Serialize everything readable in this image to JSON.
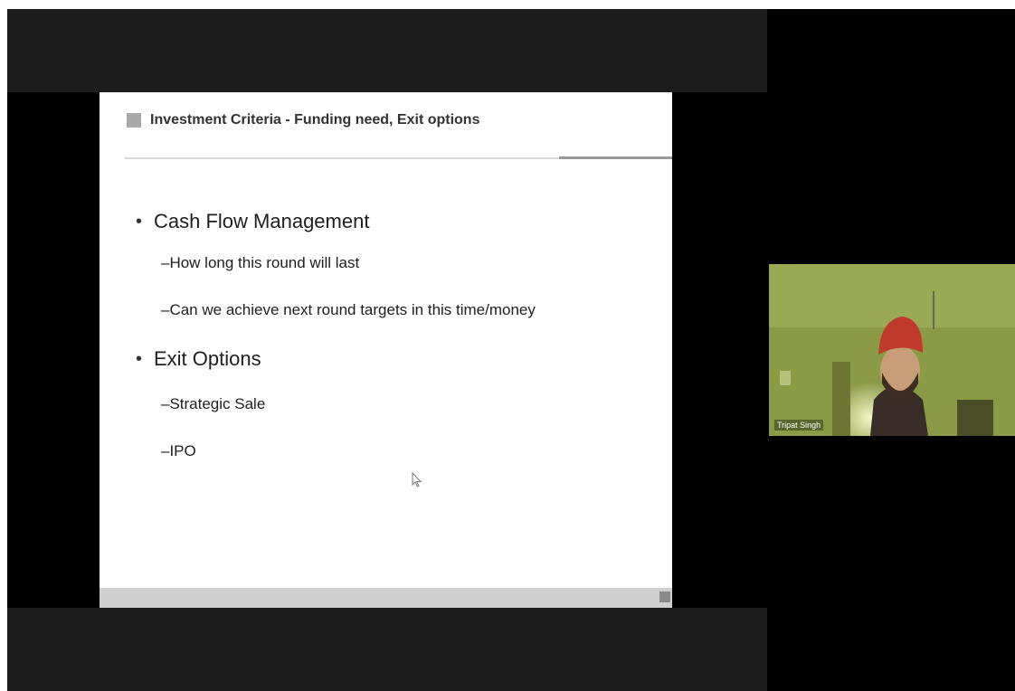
{
  "slide": {
    "title": "Investment Criteria - Funding need, Exit options",
    "bullets": [
      {
        "text": "Cash Flow Management",
        "subs": [
          "–How long this round will last",
          "–Can we achieve next round targets in this time/money"
        ]
      },
      {
        "text": "Exit Options",
        "subs": [
          "–Strategic Sale",
          "–IPO"
        ]
      }
    ],
    "bullet_glyph": "•"
  },
  "participant": {
    "name": "Tripat Singh"
  },
  "colors": {
    "background": "#000000",
    "band": "#1c1c1c",
    "slide": "#ffffff",
    "turban": "#c0392b",
    "video_bg": "#7a8a3a"
  }
}
